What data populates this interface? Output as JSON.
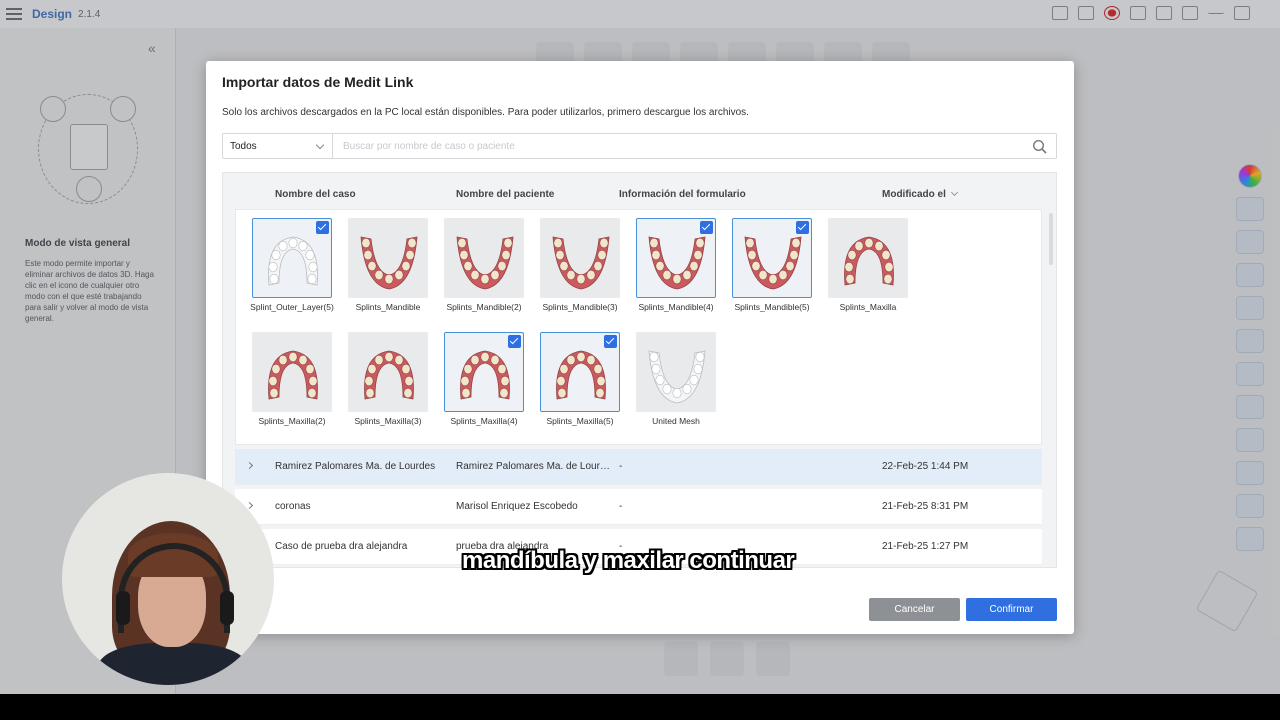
{
  "app": {
    "name": "Design",
    "version": "2.1.4"
  },
  "left_panel": {
    "title": "Modo de vista general",
    "description": "Este modo permite importar y eliminar archivos de datos 3D. Haga clic en el icono de cualquier otro modo con el que esté trabajando para salir y volver al modo de vista general."
  },
  "modal": {
    "title": "Importar datos de Medit Link",
    "subtitle": "Solo los archivos descargados en la PC local están disponibles. Para poder utilizarlos, primero descargue los archivos.",
    "filter": {
      "selected": "Todos"
    },
    "search": {
      "placeholder": "Buscar por nombre de caso o paciente",
      "value": ""
    },
    "columns": {
      "case_name": "Nombre del caso",
      "patient_name": "Nombre del paciente",
      "form_info": "Información del formulario",
      "modified": "Modificado el"
    },
    "thumbnails": [
      {
        "label": "Splint_Outer_Layer(5)",
        "selected": true,
        "kind": "clear-maxilla"
      },
      {
        "label": "Splints_Mandible",
        "selected": false,
        "kind": "mandible"
      },
      {
        "label": "Splints_Mandible(2)",
        "selected": false,
        "kind": "mandible"
      },
      {
        "label": "Splints_Mandible(3)",
        "selected": false,
        "kind": "mandible"
      },
      {
        "label": "Splints_Mandible(4)",
        "selected": true,
        "kind": "mandible"
      },
      {
        "label": "Splints_Mandible(5)",
        "selected": true,
        "kind": "mandible"
      },
      {
        "label": "Splints_Maxilla",
        "selected": false,
        "kind": "maxilla"
      },
      {
        "label": "Splints_Maxilla(2)",
        "selected": false,
        "kind": "maxilla"
      },
      {
        "label": "Splints_Maxilla(3)",
        "selected": false,
        "kind": "maxilla"
      },
      {
        "label": "Splints_Maxilla(4)",
        "selected": true,
        "kind": "maxilla"
      },
      {
        "label": "Splints_Maxilla(5)",
        "selected": true,
        "kind": "maxilla"
      },
      {
        "label": "United Mesh",
        "selected": false,
        "kind": "clear-mandible"
      }
    ],
    "rows": [
      {
        "case": "Ramirez Palomares Ma. de Lourdes",
        "patient": "Ramirez Palomares Ma. de Lourdes",
        "form": "-",
        "modified": "22-Feb-25 1:44 PM",
        "highlighted": true
      },
      {
        "case": "coronas",
        "patient": "Marisol Enriquez Escobedo",
        "form": "-",
        "modified": "21-Feb-25 8:31 PM",
        "highlighted": false
      },
      {
        "case": "Caso de prueba dra alejandra",
        "patient": "prueba dra alejandra",
        "form": "-",
        "modified": "21-Feb-25 1:27 PM",
        "highlighted": false
      }
    ],
    "buttons": {
      "cancel": "Cancelar",
      "confirm": "Confirmar"
    }
  },
  "caption": "mandíbula y maxilar continuar",
  "colors": {
    "accent": "#2f6fe0",
    "cancel": "#8d9196",
    "highlight_row": "#e3edf9",
    "gum": "#c95a5f",
    "tooth": "#efe6cc"
  }
}
